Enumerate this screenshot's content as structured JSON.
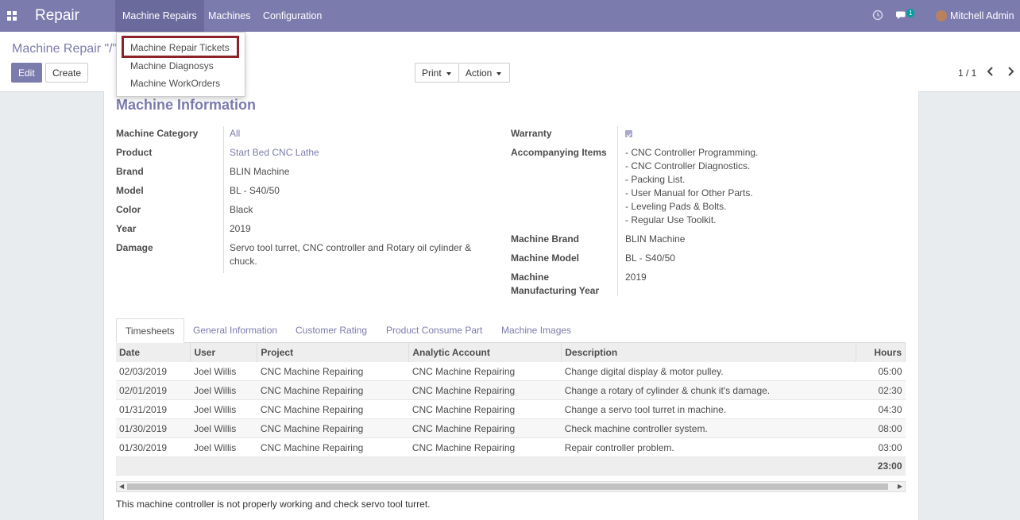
{
  "navbar": {
    "apps_icon": "grid-icon",
    "brand": "Repair",
    "menus": [
      "Machine Repairs",
      "Machines",
      "Configuration"
    ],
    "activity_icon": "clock-icon",
    "messages_icon": "chat-icon",
    "messages_badge": "1",
    "user_name": "Mitchell Admin"
  },
  "dropdown": {
    "items": [
      "Machine Repair Tickets",
      "Machine Diagnosys",
      "Machine WorkOrders"
    ]
  },
  "control": {
    "breadcrumb": "Machine Repair \"/\"",
    "edit": "Edit",
    "create": "Create",
    "print": "Print",
    "action": "Action",
    "pager": "1 / 1"
  },
  "form": {
    "section_title": "Machine Information",
    "left_fields": [
      {
        "label": "Machine Category",
        "value": "All"
      },
      {
        "label": "Product",
        "value": "Start Bed CNC Lathe"
      },
      {
        "label": "Brand",
        "value": "BLIN Machine"
      },
      {
        "label": "Model",
        "value": "BL - S40/50"
      },
      {
        "label": "Color",
        "value": "Black"
      },
      {
        "label": "Year",
        "value": "2019"
      },
      {
        "label": "Damage",
        "value": "Servo tool turret, CNC controller and Rotary oil cylinder &",
        "value2": "chuck."
      }
    ],
    "warranty_label": "Warranty",
    "warranty_checked": true,
    "accompanying_label": "Accompanying Items",
    "accompanying_items": [
      "- CNC Controller Programming.",
      "- CNC Controller Diagnostics.",
      "- Packing List.",
      "- User Manual for Other Parts.",
      "- Leveling Pads & Bolts.",
      "- Regular Use Toolkit."
    ],
    "machine_brand_label": "Machine Brand",
    "machine_brand": "BLIN Machine",
    "machine_model_label": "Machine Model",
    "machine_model": "BL - S40/50",
    "mfg_year_label_1": "Machine",
    "mfg_year_label_2": "Manufacturing Year",
    "mfg_year": "2019"
  },
  "tabs": [
    "Timesheets",
    "General Information",
    "Customer Rating",
    "Product Consume Part",
    "Machine Images"
  ],
  "timesheet": {
    "columns": [
      "Date",
      "User",
      "Project",
      "Analytic Account",
      "Description",
      "Hours"
    ],
    "rows": [
      [
        "02/03/2019",
        "Joel Willis",
        "CNC Machine Repairing",
        "CNC Machine Repairing",
        "Change digital display & motor pulley.",
        "05:00"
      ],
      [
        "02/01/2019",
        "Joel Willis",
        "CNC Machine Repairing",
        "CNC Machine Repairing",
        "Change a rotary of cylinder & chunk it's damage.",
        "02:30"
      ],
      [
        "01/31/2019",
        "Joel Willis",
        "CNC Machine Repairing",
        "CNC Machine Repairing",
        "Change a servo tool turret in machine.",
        "04:30"
      ],
      [
        "01/30/2019",
        "Joel Willis",
        "CNC Machine Repairing",
        "CNC Machine Repairing",
        "Check machine controller system.",
        "08:00"
      ],
      [
        "01/30/2019",
        "Joel Willis",
        "CNC Machine Repairing",
        "CNC Machine Repairing",
        "Repair controller problem.",
        "03:00"
      ]
    ],
    "total": "23:00"
  },
  "footer_note": "This machine controller is not properly working and check servo tool turret."
}
